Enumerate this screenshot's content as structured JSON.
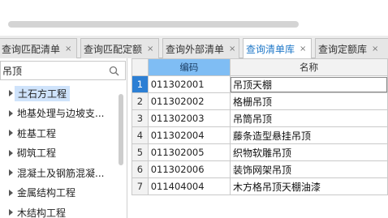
{
  "tabs": [
    {
      "label": "查询匹配清单",
      "close": "×",
      "active": false
    },
    {
      "label": "查询匹配定额",
      "close": "×",
      "active": false
    },
    {
      "label": "查询外部清单",
      "close": "×",
      "active": false
    },
    {
      "label": "查询清单库",
      "close": "×",
      "active": true
    },
    {
      "label": "查询定额库",
      "close": "×",
      "active": false
    }
  ],
  "search": {
    "value": "吊顶",
    "icon": "search-icon"
  },
  "tree": {
    "items": [
      {
        "label": "土石方工程",
        "selected": true
      },
      {
        "label": "地基处理与边坡支...",
        "selected": false
      },
      {
        "label": "桩基工程",
        "selected": false
      },
      {
        "label": "砌筑工程",
        "selected": false
      },
      {
        "label": "混凝土及钢筋混凝...",
        "selected": false
      },
      {
        "label": "金属结构工程",
        "selected": false
      },
      {
        "label": "木结构工程",
        "selected": false
      }
    ]
  },
  "grid": {
    "columns": {
      "code": "编码",
      "name": "名称"
    },
    "rows": [
      {
        "num": "1",
        "code": "011302001",
        "name": "吊顶天棚"
      },
      {
        "num": "2",
        "code": "011302002",
        "name": "格栅吊顶"
      },
      {
        "num": "3",
        "code": "011302003",
        "name": "吊筒吊顶"
      },
      {
        "num": "4",
        "code": "011302004",
        "name": "藤条造型悬挂吊顶"
      },
      {
        "num": "5",
        "code": "011302005",
        "name": "织物软雕吊顶"
      },
      {
        "num": "6",
        "code": "011302006",
        "name": "装饰网架吊顶"
      },
      {
        "num": "7",
        "code": "011404004",
        "name": "木方格吊顶天棚油漆"
      }
    ]
  },
  "colors": {
    "accent": "#1f78c8",
    "header_highlight": "#7fbdf4",
    "active_row": "#2c7fd4",
    "selection": "#cfe3fb"
  }
}
